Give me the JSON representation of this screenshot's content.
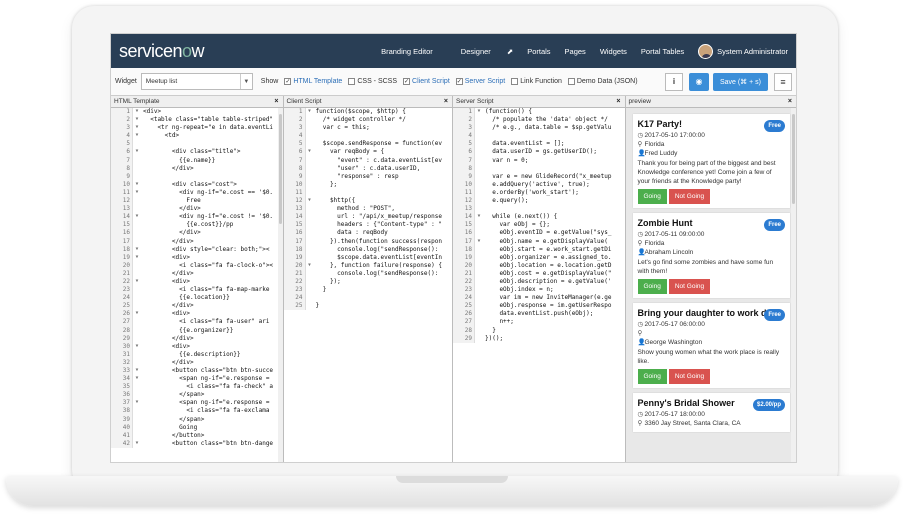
{
  "brand": {
    "prefix": "servicen",
    "o": "o",
    "suffix": "w"
  },
  "nav": {
    "items": [
      "Branding Editor",
      "Designer",
      "Portals",
      "Pages",
      "Widgets",
      "Portal Tables"
    ],
    "designer_icon": "external-link-icon",
    "user": "System Administrator"
  },
  "toolbar": {
    "widget_label": "Widget",
    "widget_value": "Meetup list",
    "show_label": "Show",
    "toggles": [
      {
        "label": "HTML Template",
        "checked": true
      },
      {
        "label": "CSS - SCSS",
        "checked": false
      },
      {
        "label": "Client Script",
        "checked": true
      },
      {
        "label": "Server Script",
        "checked": true
      },
      {
        "label": "Link Function",
        "checked": false
      },
      {
        "label": "Demo Data (JSON)",
        "checked": false
      }
    ],
    "info_label": "i",
    "save_label": "Save (⌘ + s)",
    "menu_icon": "≡"
  },
  "panes": {
    "html": {
      "title": "HTML Template",
      "lines": [
        "<div>",
        "  <table class=\"table table-striped\"",
        "    <tr ng-repeat=\"e in data.eventLi",
        "      <td>",
        "",
        "        <div class=\"title\">",
        "          {{e.name}}",
        "        </div>",
        "",
        "        <div class=\"cost\">",
        "          <div ng-if=\"e.cost == '$0.",
        "            Free",
        "          </div>",
        "          <div ng-if=\"e.cost != '$0.",
        "            {{e.cost}}/pp",
        "          </div>",
        "        </div>",
        "        <div style=\"clear: both;\"><",
        "        <div>",
        "          <i class=\"fa fa-clock-o\"><",
        "        </div>",
        "        <div>",
        "          <i class=\"fa fa-map-marke",
        "          {{e.location}}",
        "        </div>",
        "        <div>",
        "          <i class=\"fa fa-user\" ari",
        "          {{e.organizer}}",
        "        </div>",
        "        <div>",
        "          {{e.description}}",
        "        </div>",
        "        <button class=\"btn btn-succe",
        "          <span ng-if=\"e.response =",
        "            <i class=\"fa fa-check\" a",
        "          </span>",
        "          <span ng-if=\"e.response =",
        "            <i class=\"fa fa-exclama",
        "          </span>",
        "          Going",
        "        </button>",
        "        <button class=\"btn btn-dange"
      ]
    },
    "client": {
      "title": "Client Script",
      "lines": [
        "function($scope, $http) {",
        "  /* widget controller */",
        "  var c = this;",
        "",
        "  $scope.sendResponse = function(ev",
        "    var reqBody = {",
        "      \"event\" : c.data.eventList[ev",
        "      \"user\" : c.data.userID,",
        "      \"response\" : resp",
        "    };",
        "",
        "    $http({",
        "      method : \"POST\",",
        "      url : \"/api/x_meetup/response",
        "      headers : {\"Content-type\" : \"",
        "      data : reqBody",
        "    }).then(function success(respon",
        "      console.log(\"sendResponse(): ",
        "      $scope.data.eventList[eventIn",
        "    }, function failure(response) {",
        "      console.log(\"sendResponse(): ",
        "    });",
        "  }",
        "",
        "}"
      ]
    },
    "server": {
      "title": "Server Script",
      "lines": [
        "(function() {",
        "  /* populate the 'data' object */",
        "  /* e.g., data.table = $sp.getValu",
        "",
        "  data.eventList = [];",
        "  data.userID = gs.getUserID();",
        "  var n = 0;",
        "",
        "  var e = new GlideRecord(\"x_meetup",
        "  e.addQuery('active', true);",
        "  e.orderBy('work_start');",
        "  e.query();",
        "",
        "  while (e.next()) {",
        "    var eObj = {};",
        "    eObj.eventID = e.getValue(\"sys_",
        "    eObj.name = e.getDisplayValue(",
        "    eObj.start = e.work_start.getDi",
        "    eObj.organizer = e.assigned_to.",
        "    eObj.location = e.location.getD",
        "    eObj.cost = e.getDisplayValue(\"",
        "    eObj.description = e.getValue('",
        "    eObj.index = n;",
        "    var im = new InviteManager(e.ge",
        "    eObj.response = im.getUserRespo",
        "    data.eventList.push(eObj);",
        "    n++;",
        "  }",
        "})();"
      ]
    },
    "preview": {
      "title": "preview",
      "going_label": "Going",
      "not_going_label": "Not Going",
      "events": [
        {
          "name": "K17 Party!",
          "cost": "Free",
          "start": "2017-05-10 17:00:00",
          "location": "Florida",
          "organizer": "Fred Luddy",
          "description": "Thank you for being part of the biggest and best Knowledge conference yet! Come join a few of your friends at the Knowledge party!"
        },
        {
          "name": "Zombie Hunt",
          "cost": "Free",
          "start": "2017-05-11 09:00:00",
          "location": "Florida",
          "organizer": "Abraham Lincoln",
          "description": "Let's go find some zombies and have some fun with them!"
        },
        {
          "name": "Bring your daughter to work day",
          "cost": "Free",
          "start": "2017-05-17 06:00:00",
          "location": "",
          "organizer": "George Washington",
          "description": "Show young women what the work place is really like."
        },
        {
          "name": "Penny's Bridal Shower",
          "cost": "$2.00/pp",
          "start": "2017-05-17 18:00:00",
          "location": "3360 Jay Street, Santa Clara, CA",
          "organizer": "",
          "description": ""
        }
      ]
    }
  }
}
